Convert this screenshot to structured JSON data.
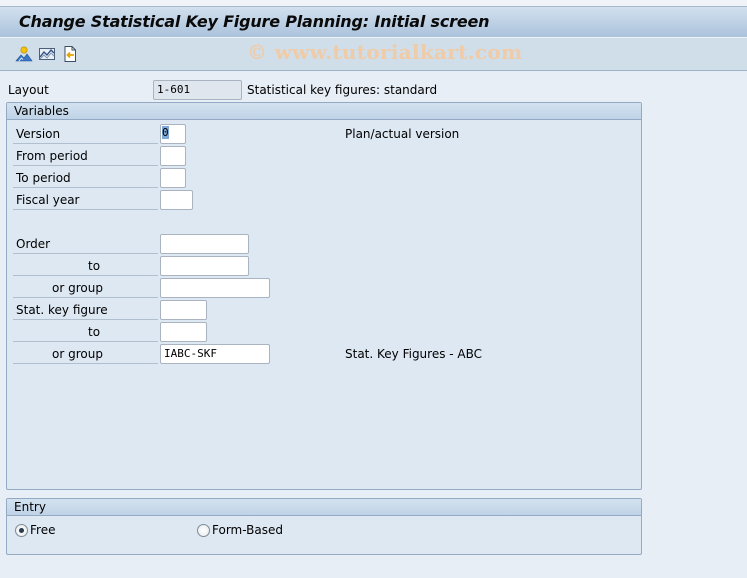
{
  "window": {
    "title": "Change Statistical Key Figure Planning: Initial screen"
  },
  "toolbar": {
    "buttons": [
      {
        "icon": "person-icon",
        "tooltip": ""
      },
      {
        "icon": "chart-line-icon",
        "tooltip": ""
      },
      {
        "icon": "document-import-icon",
        "tooltip": ""
      }
    ],
    "watermark": "© www.tutorialkart.com"
  },
  "header": {
    "layout_label": "Layout",
    "layout_value": "1-601",
    "layout_description": "Statistical key figures: standard"
  },
  "variables": {
    "title": "Variables",
    "version_label": "Version",
    "version_value": "0",
    "version_description": "Plan/actual version",
    "from_period_label": "From period",
    "from_period_value": "",
    "to_period_label": "To period",
    "to_period_value": "",
    "fiscal_year_label": "Fiscal year",
    "fiscal_year_value": "",
    "order_label": "Order",
    "order_value": "",
    "order_to_label": "to",
    "order_to_value": "",
    "order_group_label": "or group",
    "order_group_value": "",
    "skf_label": "Stat. key figure",
    "skf_value": "",
    "skf_to_label": "to",
    "skf_to_value": "",
    "skf_group_label": "or group",
    "skf_group_value": "IABC-SKF",
    "skf_group_description": "Stat. Key Figures - ABC"
  },
  "entry": {
    "title": "Entry",
    "options": [
      {
        "label": "Free",
        "checked": true
      },
      {
        "label": "Form-Based",
        "checked": false
      }
    ]
  }
}
